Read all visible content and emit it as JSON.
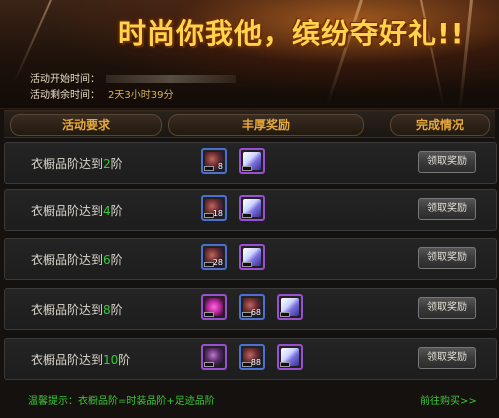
{
  "banner": {
    "title": "时尚你我他，缤纷夺好礼!!",
    "start_label": "活动开始时间：",
    "remaining_label": "活动剩余时间：",
    "remaining_value": "2天3小时39分"
  },
  "table": {
    "headers": [
      "活动要求",
      "丰厚奖励",
      "完成情况"
    ]
  },
  "rows": [
    {
      "req_prefix": "衣橱品阶达到",
      "req_level": "2",
      "req_suffix": "阶",
      "rewards": [
        {
          "icon": "fashion-chest-icon",
          "count": "8"
        },
        {
          "icon": "scroll-icon",
          "count": ""
        }
      ],
      "button": "领取奖励"
    },
    {
      "req_prefix": "衣橱品阶达到",
      "req_level": "4",
      "req_suffix": "阶",
      "rewards": [
        {
          "icon": "fashion-chest-icon",
          "count": "18"
        },
        {
          "icon": "scroll-icon",
          "count": ""
        }
      ],
      "button": "领取奖励"
    },
    {
      "req_prefix": "衣橱品阶达到",
      "req_level": "6",
      "req_suffix": "阶",
      "rewards": [
        {
          "icon": "fashion-chest-icon",
          "count": "28"
        },
        {
          "icon": "scroll-icon",
          "count": ""
        }
      ],
      "button": "领取奖励"
    },
    {
      "req_prefix": "衣橱品阶达到",
      "req_level": "8",
      "req_suffix": "阶",
      "rewards": [
        {
          "icon": "pink-gem-icon",
          "count": ""
        },
        {
          "icon": "fashion-chest-icon",
          "count": "68"
        },
        {
          "icon": "scroll-icon",
          "count": ""
        }
      ],
      "button": "领取奖励"
    },
    {
      "req_prefix": "衣橱品阶达到",
      "req_level": "10",
      "req_suffix": "阶",
      "rewards": [
        {
          "icon": "costume-icon",
          "count": ""
        },
        {
          "icon": "fashion-chest-icon",
          "count": "88"
        },
        {
          "icon": "scroll-icon",
          "count": ""
        }
      ],
      "button": "领取奖励"
    }
  ],
  "footer": {
    "tip": "温馨提示：衣橱品阶=时装品阶+足迹品阶",
    "link": "前往购买>>"
  },
  "colors": {
    "title_gold": "#ffd34d",
    "header_orange": "#e8a93a",
    "level_green": "#38c93a",
    "footer_green": "#3cc83a"
  }
}
